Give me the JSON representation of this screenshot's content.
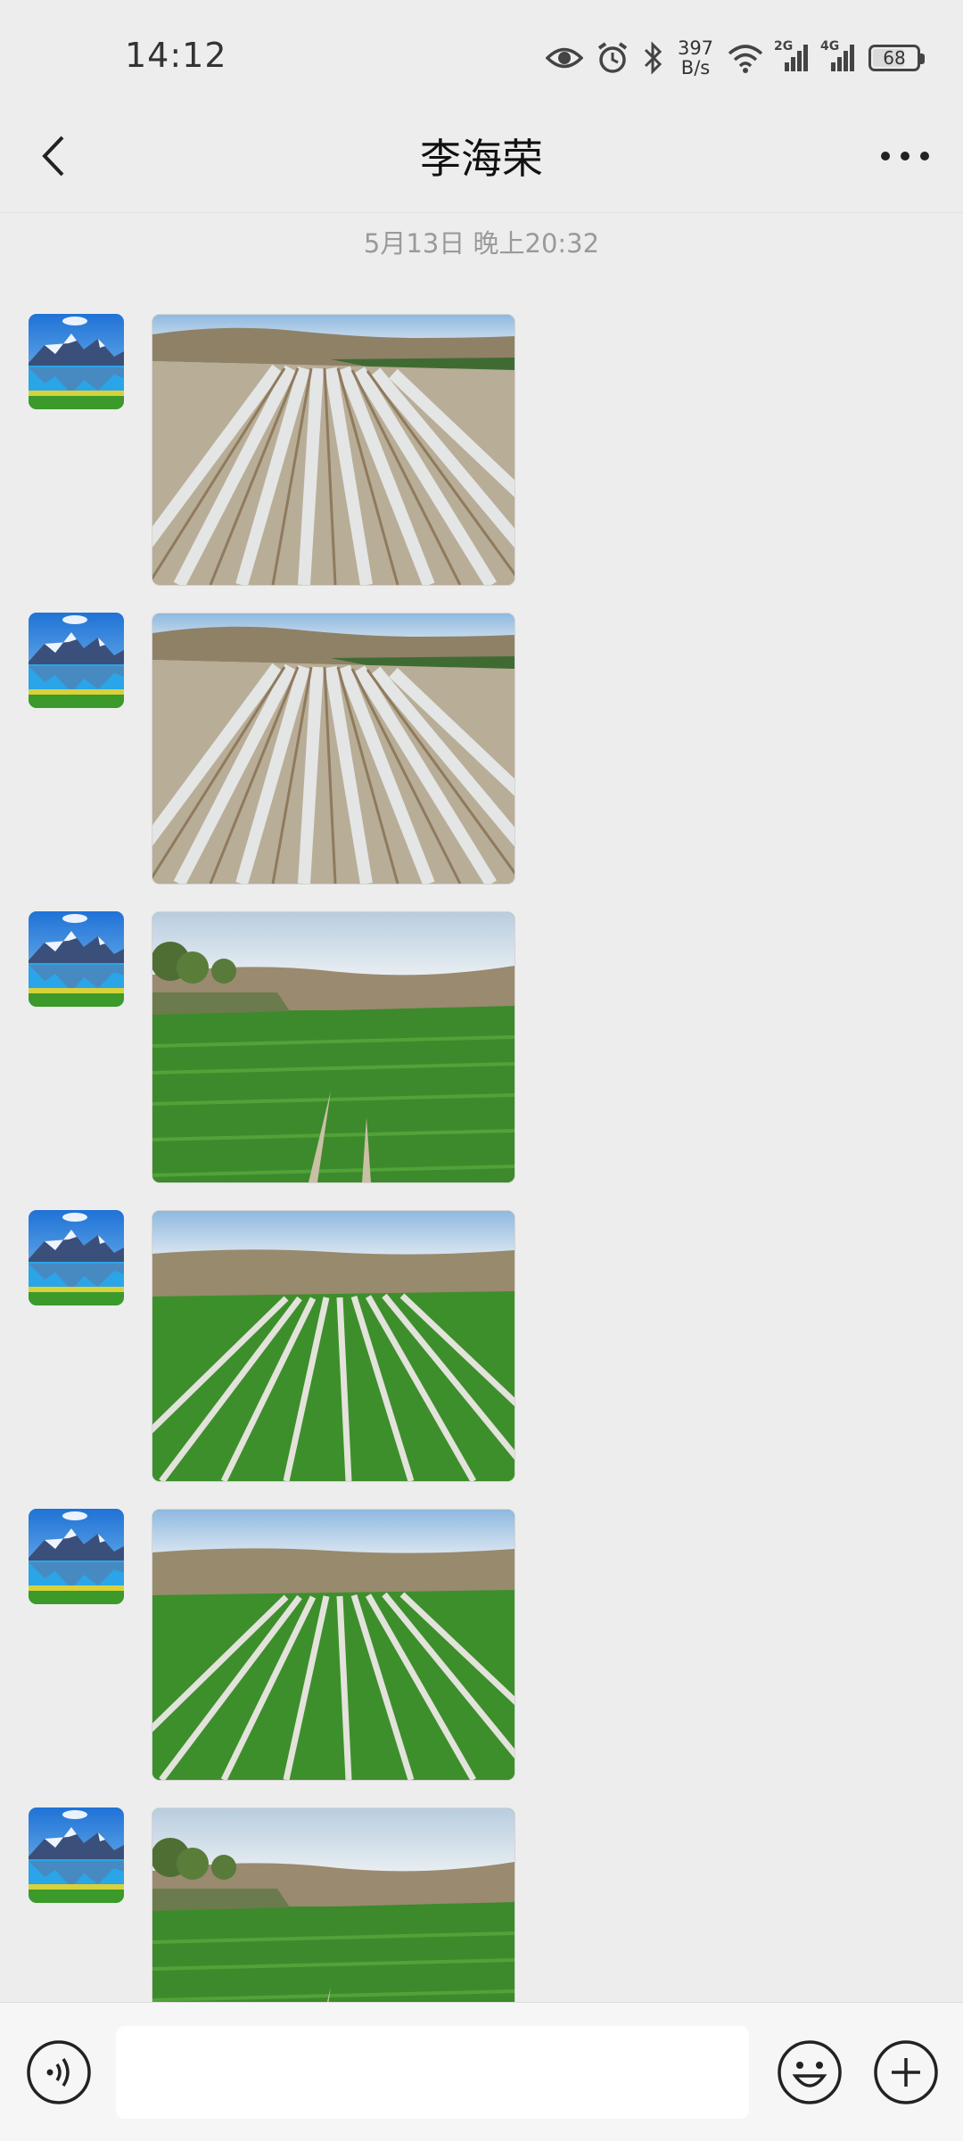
{
  "status_bar": {
    "time": "14:12",
    "net_speed_value": "397",
    "net_speed_unit": "B/s",
    "signal_2g_label": "2G",
    "signal_4g_label": "4G",
    "battery_level": "68"
  },
  "header": {
    "title": "李海荣"
  },
  "chat": {
    "timestamp": "5月13日 晚上20:32",
    "messages": [
      {
        "type": "image",
        "scene": "plastic-mulch-field"
      },
      {
        "type": "image",
        "scene": "plastic-mulch-field"
      },
      {
        "type": "image",
        "scene": "green-crop-field-trees"
      },
      {
        "type": "image",
        "scene": "green-crop-rows"
      },
      {
        "type": "image",
        "scene": "green-crop-rows"
      },
      {
        "type": "image",
        "scene": "green-crop-field-trees"
      }
    ]
  },
  "input_bar": {
    "message_value": "",
    "placeholder": ""
  },
  "colors": {
    "background": "#ededed",
    "input_bar": "#f6f6f6",
    "timestamp": "#9a9a9a"
  },
  "icons": [
    "back-icon",
    "more-icon",
    "voice-icon",
    "emoji-icon",
    "plus-icon",
    "eye-icon",
    "alarm-icon",
    "bluetooth-icon",
    "wifi-icon",
    "signal-icon",
    "battery-icon"
  ]
}
